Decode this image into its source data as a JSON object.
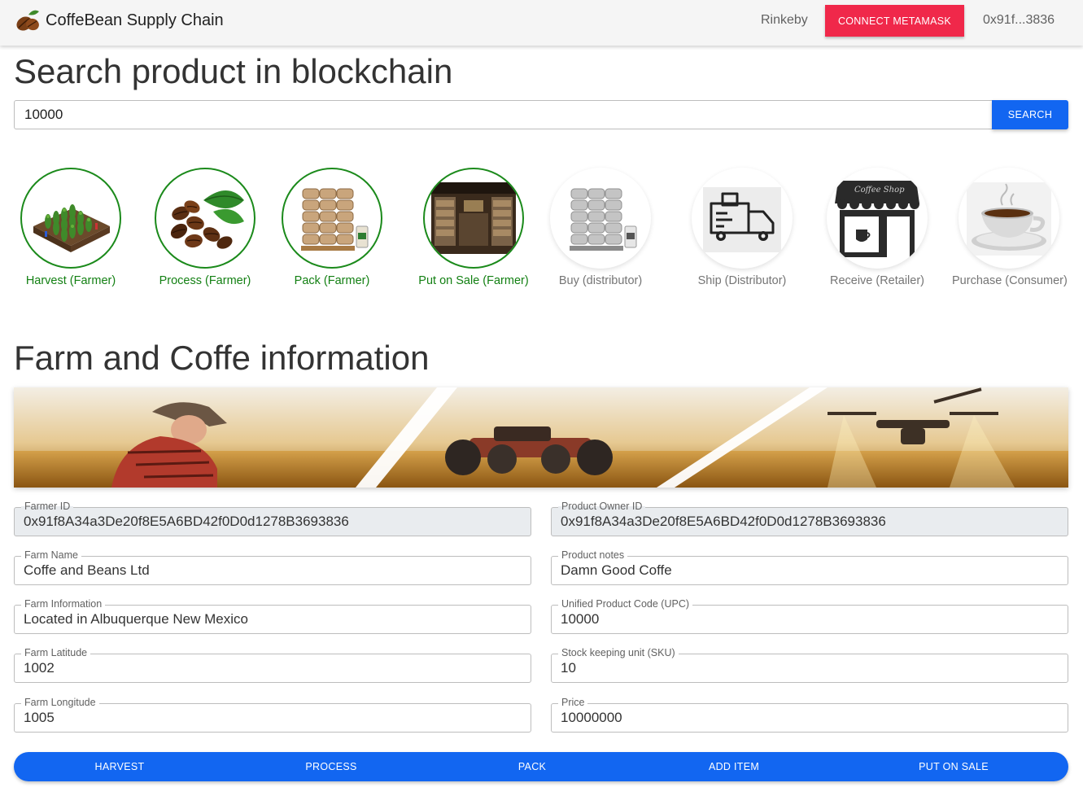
{
  "header": {
    "title": "CoffeBean Supply Chain",
    "network": "Rinkeby",
    "connect_label": "CONNECT METAMASK",
    "account": "0x91f...3836"
  },
  "search": {
    "heading": "Search product in blockchain",
    "value": "10000",
    "button_label": "SEARCH"
  },
  "steps": [
    {
      "label": "Harvest (Farmer)",
      "completed": true
    },
    {
      "label": "Process (Farmer)",
      "completed": true
    },
    {
      "label": "Pack (Farmer)",
      "completed": true
    },
    {
      "label": "Put on Sale (Farmer)",
      "completed": true
    },
    {
      "label": "Buy (distributor)",
      "completed": false
    },
    {
      "label": "Ship (Distributor)",
      "completed": false
    },
    {
      "label": "Receive (Retailer)",
      "completed": false
    },
    {
      "label": "Purchase (Consumer)",
      "completed": false
    }
  ],
  "farm_section": {
    "heading": "Farm and Coffe information"
  },
  "fields": {
    "farmer_id": {
      "label": "Farmer ID",
      "value": "0x91f8A34a3De20f8E5A6BD42f0D0d1278B3693836",
      "readonly": true
    },
    "product_owner_id": {
      "label": "Product Owner ID",
      "value": "0x91f8A34a3De20f8E5A6BD42f0D0d1278B3693836",
      "readonly": true
    },
    "farm_name": {
      "label": "Farm Name",
      "value": "Coffe and Beans Ltd"
    },
    "product_notes": {
      "label": "Product notes",
      "value": "Damn Good Coffe"
    },
    "farm_information": {
      "label": "Farm Information",
      "value": "Located in Albuquerque New Mexico"
    },
    "upc": {
      "label": "Unified Product Code (UPC)",
      "value": "10000"
    },
    "farm_latitude": {
      "label": "Farm Latitude",
      "value": "1002"
    },
    "sku": {
      "label": "Stock keeping unit (SKU)",
      "value": "10"
    },
    "farm_longitude": {
      "label": "Farm Longitude",
      "value": "1005"
    },
    "price": {
      "label": "Price",
      "value": "10000000"
    }
  },
  "actions": {
    "harvest": "HARVEST",
    "process": "PROCESS",
    "pack": "PACK",
    "add_item": "ADD ITEM",
    "put_on_sale": "PUT ON SALE"
  },
  "colors": {
    "primary": "#1266f1",
    "connect": "#f0284a",
    "completed": "#1b8a1b"
  }
}
